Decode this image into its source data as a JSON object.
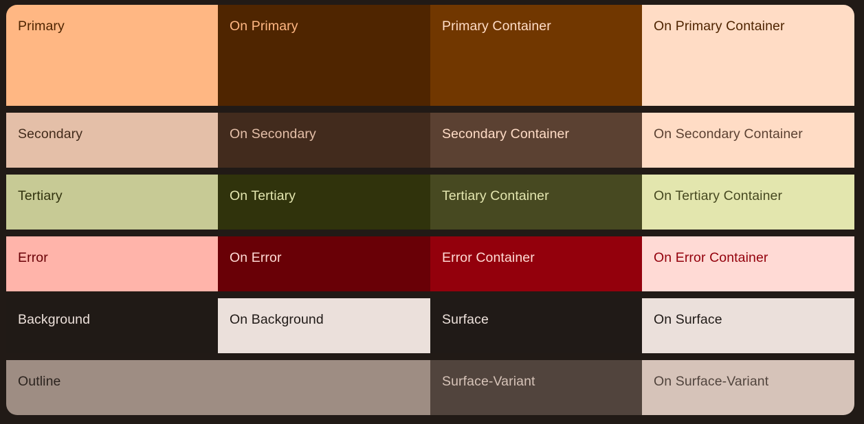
{
  "rows": [
    [
      {
        "label": "Primary",
        "bg": "#ffb783",
        "fg": "#4e2400"
      },
      {
        "label": "On Primary",
        "bg": "#4f2500",
        "fg": "#ffb783"
      },
      {
        "label": "Primary Container",
        "bg": "#713700",
        "fg": "#ffdcc6"
      },
      {
        "label": "On Primary Container",
        "bg": "#ffdcc5",
        "fg": "#4e2400"
      }
    ],
    [
      {
        "label": "Secondary",
        "bg": "#e4bfa8",
        "fg": "#422b1b"
      },
      {
        "label": "On Secondary",
        "bg": "#422b1d",
        "fg": "#e4bfa8"
      },
      {
        "label": "Secondary Container",
        "bg": "#5b4132",
        "fg": "#ffdcc6"
      },
      {
        "label": "On Secondary Container",
        "bg": "#ffdcc5",
        "fg": "#5b4132"
      }
    ],
    [
      {
        "label": "Tertiary",
        "bg": "#c7ca95",
        "fg": "#31320e"
      },
      {
        "label": "On Tertiary",
        "bg": "#30330c",
        "fg": "#e4e6af"
      },
      {
        "label": "Tertiary Container",
        "bg": "#474921",
        "fg": "#e4e6af"
      },
      {
        "label": "On Tertiary Container",
        "bg": "#e3e6ae",
        "fg": "#474921"
      }
    ],
    [
      {
        "label": "Error",
        "bg": "#ffb4aa",
        "fg": "#690006"
      },
      {
        "label": "On Error",
        "bg": "#690006",
        "fg": "#ffdad5"
      },
      {
        "label": "Error Container",
        "bg": "#93000c",
        "fg": "#ffdad5"
      },
      {
        "label": "On Error Container",
        "bg": "#ffdad5",
        "fg": "#93000c"
      }
    ],
    [
      {
        "label": "Background",
        "bg": "#201a16",
        "fg": "#ece0da"
      },
      {
        "label": "On Background",
        "bg": "#ebe0db",
        "fg": "#201a17"
      },
      {
        "label": "Surface",
        "bg": "#201a17",
        "fg": "#ece0da"
      },
      {
        "label": "On Surface",
        "bg": "#ebe0db",
        "fg": "#201a17"
      }
    ],
    [
      {
        "label": "Outline",
        "bg": "#9e8d83",
        "fg": "#2b231e",
        "span": 2
      },
      {
        "label": "Surface-Variant",
        "bg": "#51443d",
        "fg": "#d6c3b8"
      },
      {
        "label": "On Surface-Variant",
        "bg": "#d6c3b9",
        "fg": "#51443d"
      }
    ]
  ]
}
